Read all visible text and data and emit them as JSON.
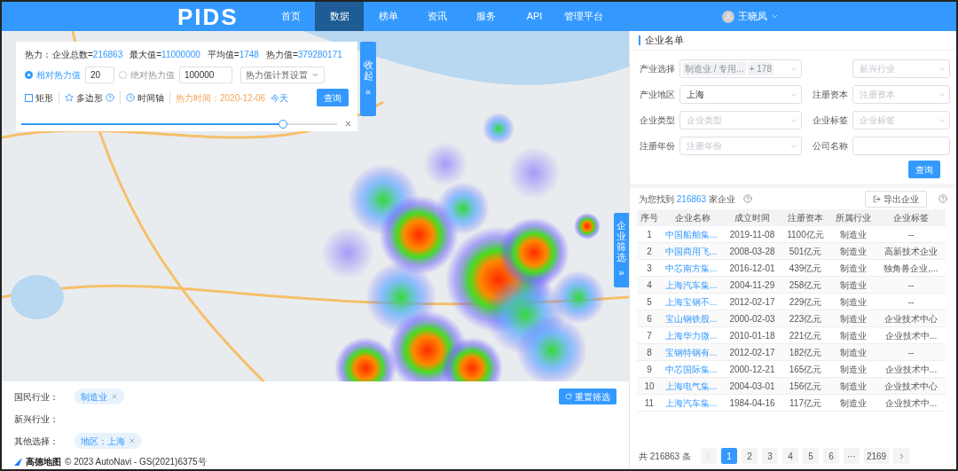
{
  "nav": {
    "logo": "PIDS",
    "items": [
      {
        "label": "首页",
        "selected": false
      },
      {
        "label": "数据",
        "selected": true
      },
      {
        "label": "榜单",
        "selected": false
      },
      {
        "label": "资讯",
        "selected": false
      },
      {
        "label": "服务",
        "selected": false
      },
      {
        "label": "API",
        "selected": false
      },
      {
        "label": "管理平台",
        "selected": false
      }
    ],
    "user": "王晓凤"
  },
  "heat_panel": {
    "prefix": "热力：",
    "stats": [
      {
        "label": "企业总数=",
        "value": "216863"
      },
      {
        "label": "最大值=",
        "value": "11000000"
      },
      {
        "label": "平均值=",
        "value": "1748"
      },
      {
        "label": "热力值=",
        "value": "379280171"
      }
    ],
    "modes": [
      {
        "label": "相对热力值",
        "selected": true,
        "value": "20"
      },
      {
        "label": "绝对热力值",
        "selected": false,
        "value": "100000"
      }
    ],
    "settings": "热力值计算设置",
    "tools": [
      {
        "kind": "checkbox",
        "label": "矩形",
        "checked": false
      },
      {
        "kind": "star",
        "label": "多边形",
        "help": true
      },
      {
        "kind": "clock",
        "label": "时间轴"
      }
    ],
    "heat_time": "热力时间：2020-12-06",
    "today": "今天",
    "query": "查询",
    "slider": {
      "level": 0.83
    },
    "collapse": {
      "label": "收起",
      "arrow": "«"
    }
  },
  "side_tab": {
    "label": "企业筛选",
    "arrow": "»"
  },
  "filters": [
    {
      "label": "国民行业：",
      "tags": [
        "制造业"
      ]
    },
    {
      "label": "新兴行业："
    },
    {
      "label": "其他选择：",
      "tags": [
        "地区：上海"
      ]
    }
  ],
  "reset": "重置筛选",
  "attribution": {
    "brand": "高德地图",
    "text": "© 2023 AutoNavi - GS(2021)6375号"
  },
  "list": {
    "title": "企业名单",
    "fields": [
      {
        "kind": "select",
        "label": "产业选择",
        "tags": [
          "制造业 / 专用...",
          "+ 178"
        ]
      },
      {
        "kind": "select",
        "placeholder": "新兴行业"
      },
      {
        "kind": "select",
        "label": "产业地区",
        "value": "上海"
      },
      {
        "kind": "select",
        "label": "注册资本",
        "placeholder": "注册资本"
      },
      {
        "kind": "select",
        "label": "企业类型",
        "placeholder": "企业类型"
      },
      {
        "kind": "select",
        "label": "企业标签",
        "placeholder": "企业标签"
      },
      {
        "kind": "select",
        "label": "注册年份",
        "placeholder": "注册年份"
      },
      {
        "kind": "input",
        "label": "公司名称"
      }
    ],
    "query": "查询",
    "found_before": "为您找到",
    "found_count": "216863",
    "found_after": "家企业",
    "export": "导出企业",
    "columns": [
      "序号",
      "企业名称",
      "成立时间",
      "注册资本",
      "所属行业",
      "企业标签"
    ],
    "rows": [
      [
        "1",
        "中国船舶集...",
        "2019-11-08",
        "1100亿元",
        "制造业",
        "--"
      ],
      [
        "2",
        "中国商用飞...",
        "2008-03-28",
        "501亿元",
        "制造业",
        "高新技术企业"
      ],
      [
        "3",
        "中芯南方集...",
        "2016-12-01",
        "439亿元",
        "制造业",
        "独角兽企业,..."
      ],
      [
        "4",
        "上海汽车集...",
        "2004-11-29",
        "258亿元",
        "制造业",
        "--"
      ],
      [
        "5",
        "上海宝钢不...",
        "2012-02-17",
        "229亿元",
        "制造业",
        "--"
      ],
      [
        "6",
        "宝山钢铁股...",
        "2000-02-03",
        "223亿元",
        "制造业",
        "企业技术中心"
      ],
      [
        "7",
        "上海华力微...",
        "2010-01-18",
        "221亿元",
        "制造业",
        "企业技术中..."
      ],
      [
        "8",
        "宝钢特钢有...",
        "2012-02-17",
        "182亿元",
        "制造业",
        "--"
      ],
      [
        "9",
        "中芯国际集...",
        "2000-12-21",
        "165亿元",
        "制造业",
        "企业技术中..."
      ],
      [
        "10",
        "上海电气集...",
        "2004-03-01",
        "156亿元",
        "制造业",
        "企业技术中心"
      ],
      [
        "11",
        "上海汽车集...",
        "1984-04-16",
        "117亿元",
        "制造业",
        "企业技术中..."
      ]
    ],
    "total": "共 216863 条",
    "pages": [
      {
        "label": "1",
        "selected": true
      },
      {
        "label": "2",
        "selected": false
      },
      {
        "label": "3",
        "selected": false
      },
      {
        "label": "4",
        "selected": false
      },
      {
        "label": "5",
        "selected": false
      },
      {
        "label": "6",
        "selected": false
      },
      {
        "label": "···",
        "selected": false
      },
      {
        "label": "2169",
        "selected": false
      }
    ]
  }
}
